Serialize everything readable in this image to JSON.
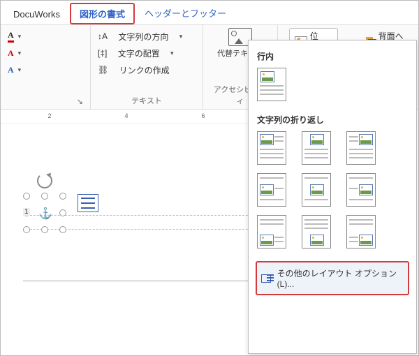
{
  "tabs": {
    "app": "DocuWorks",
    "active": "図形の書式",
    "headerfooter": "ヘッダーとフッター"
  },
  "ribbon": {
    "text_group_label": "テキスト",
    "btn_text_direction": "文字列の方向",
    "btn_text_align": "文字の配置",
    "btn_link": "リンクの作成",
    "alt_text_label": "代替テキスト",
    "accessibility_label": "アクセシビリティ",
    "position_label": "位置",
    "send_back": "背面へ移"
  },
  "ruler": {
    "major": [
      "2",
      "4",
      "6"
    ]
  },
  "canvas": {
    "page_num": "1"
  },
  "menu": {
    "inline_heading": "行内",
    "wrap_heading": "文字列の折り返し",
    "more_options": "その他のレイアウト オプション(L)..."
  },
  "chart_data": null
}
